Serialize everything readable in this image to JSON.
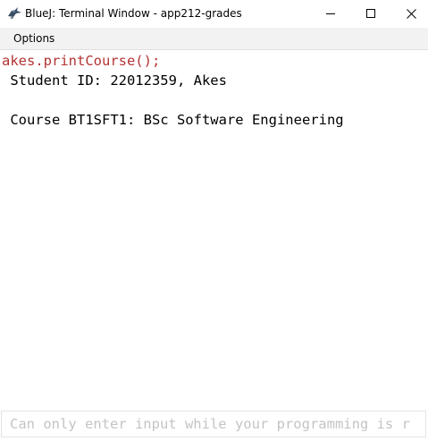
{
  "window": {
    "title": "BlueJ: Terminal Window - app212-grades"
  },
  "menu": {
    "options_label": "Options"
  },
  "terminal": {
    "lines": [
      "akes.printCourse();",
      " Student ID: 22012359, Akes",
      "",
      " Course BT1SFT1: BSc Software Engineering"
    ],
    "command_color": "#b33434"
  },
  "input": {
    "placeholder": "Can only enter input while your programming is r",
    "value": ""
  },
  "icons": {
    "app": "bluej-bird-icon",
    "minimize": "minimize-icon",
    "maximize": "maximize-icon",
    "close": "close-icon"
  }
}
